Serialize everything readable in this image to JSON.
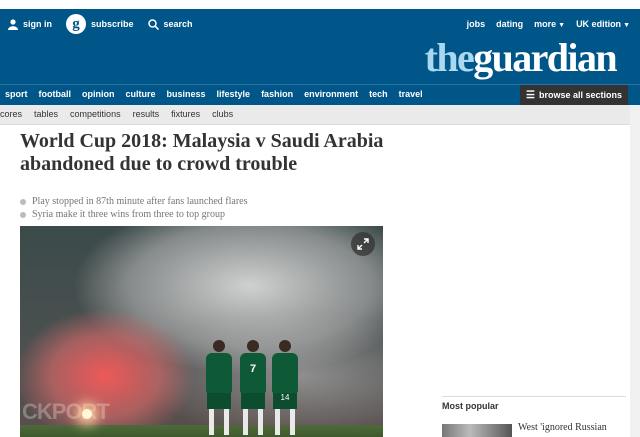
{
  "topbar": {
    "sign_in": "sign in",
    "logo_letter": "g",
    "subscribe": "subscribe",
    "search": "search",
    "jobs": "jobs",
    "dating": "dating",
    "more": "more",
    "edition": "UK edition"
  },
  "brand": {
    "the": "the",
    "guardian": "guardian"
  },
  "nav": {
    "items": [
      "sport",
      "football",
      "opinion",
      "culture",
      "business",
      "lifestyle",
      "fashion",
      "environment",
      "tech",
      "travel"
    ],
    "browse": "browse all sections"
  },
  "subnav": {
    "items": [
      "cores",
      "tables",
      "competitions",
      "results",
      "fixtures",
      "clubs"
    ]
  },
  "article": {
    "headline": "World Cup 2018: Malaysia v Saudi Arabia abandoned due to crowd trouble",
    "standfirst": [
      "Play stopped in 87th minute after fans launched flares",
      "Syria make it three wins from three to top group"
    ],
    "photo": {
      "watermark": "CKPORT",
      "numbers": [
        "7",
        "14"
      ]
    }
  },
  "most_popular": {
    "title": "Most popular",
    "first_item": "West 'ignored Russian"
  },
  "colors": {
    "brand_blue": "#005689",
    "browse_bg": "#333333",
    "brand_light": "#aad8f1"
  }
}
